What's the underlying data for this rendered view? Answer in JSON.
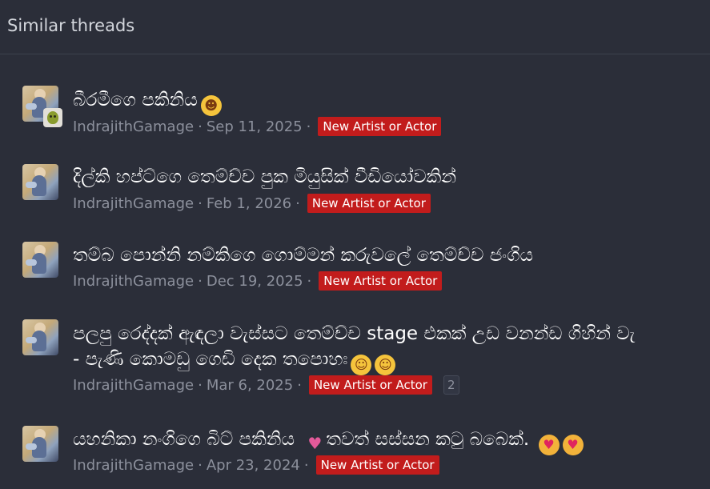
{
  "block": {
    "title": "Similar threads"
  },
  "threads": [
    {
      "title": "බීරමීගෙ පකිනිය",
      "emoji_1": "grinning-face-icon",
      "author": "IndrajithGamage",
      "date": "Sep 11, 2025",
      "label": "New Artist or Actor",
      "has_secondary_avatar": true
    },
    {
      "title": "දිල්කි හප්ට්ගෙ තෙම්ච්ච පුක මියුසික් වීඩියෝවකින්",
      "author": "IndrajithGamage",
      "date": "Feb 1, 2026",
      "label": "New Artist or Actor"
    },
    {
      "title": "තම්බ පොන්නි නම්කිගෙ ගොම්මන් කරුවලේ තෙම්ච්ච ජංගිය",
      "author": "IndrajithGamage",
      "date": "Dec 19, 2025",
      "label": "New Artist or Actor"
    },
    {
      "title_line1": "පලපු රෙද්දක් ඇඳලා වැස්සට තෙම්ච්ච stage එකක් උඩ වනන්ඩ ගිහින් වැ",
      "title_line2": "- පැණි කොමඩු ගෙඩි දෙක තපොහඃ",
      "emoji": [
        "rolling-on-floor-laughing-icon",
        "rolling-on-floor-laughing-icon"
      ],
      "author": "IndrajithGamage",
      "date": "Mar 6, 2025",
      "label": "New Artist or Actor",
      "replies": "2"
    },
    {
      "title_part1": "යහනිකා නංගිගෙ බිට් පකිනිය",
      "title_part2": "තවත් සස්සන කටු බබෙක්.",
      "emoji": [
        "bikini-icon",
        "star-struck-icon",
        "star-struck-icon"
      ],
      "author": "IndrajithGamage",
      "date": "Apr 23, 2024",
      "label": "New Artist or Actor"
    }
  ],
  "colors": {
    "background": "#2b2e39",
    "title_text": "#ffffff",
    "meta_text": "#8c909c",
    "label_bg": "#c21c1c",
    "divider": "#3d414d"
  }
}
